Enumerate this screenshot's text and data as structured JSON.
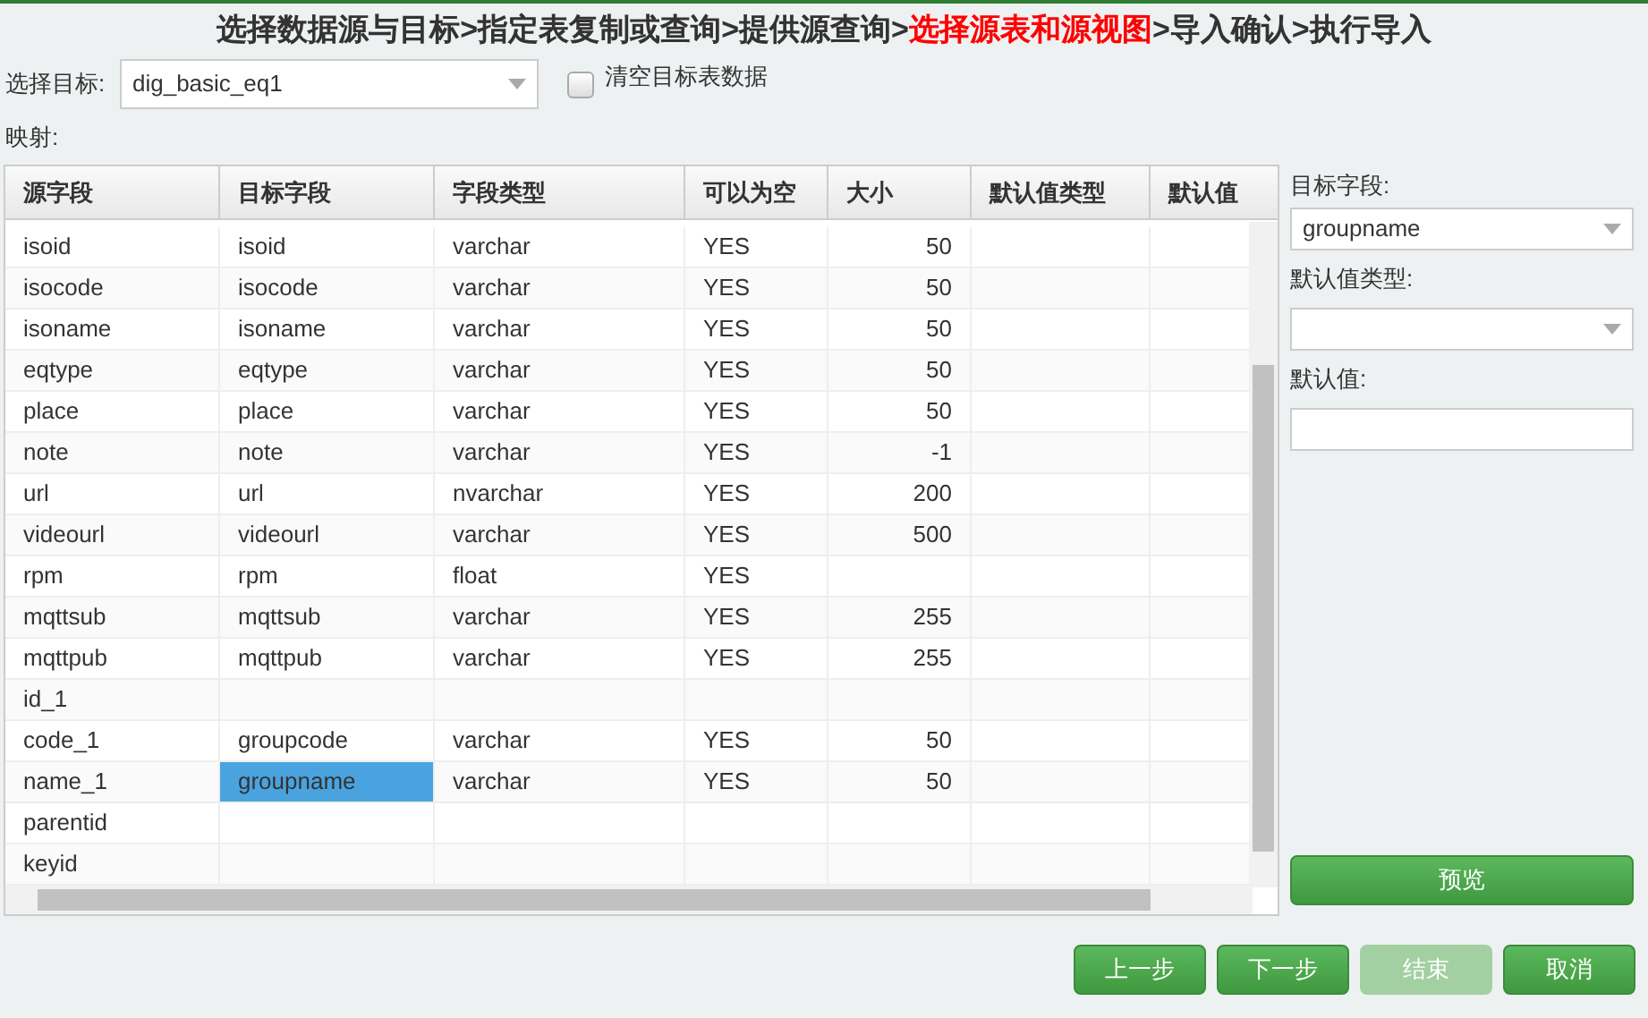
{
  "steps": [
    {
      "label": "选择数据源与目标",
      "current": false,
      "sep": ">"
    },
    {
      "label": "指定表复制或查询",
      "current": false,
      "sep": ">"
    },
    {
      "label": "提供源查询",
      "current": false,
      "sep": ">"
    },
    {
      "label": "选择源表和源视图",
      "current": true,
      "sep": ">"
    },
    {
      "label": "导入确认",
      "current": false,
      "sep": ">"
    },
    {
      "label": "执行导入",
      "current": false
    }
  ],
  "target": {
    "label": "选择目标:",
    "value": "dig_basic_eq1"
  },
  "clear_checkbox": {
    "label": "清空目标表数据",
    "checked": false
  },
  "mapping_label": "映射:",
  "table": {
    "columns": [
      "源字段",
      "目标字段",
      "字段类型",
      "可以为空",
      "大小",
      "默认值类型",
      "默认值"
    ],
    "rows": [
      {
        "cells": [
          "isoid",
          "isoid",
          "varchar",
          "YES",
          "50"
        ],
        "selected": false
      },
      {
        "cells": [
          "isocode",
          "isocode",
          "varchar",
          "YES",
          "50"
        ],
        "selected": false
      },
      {
        "cells": [
          "isoname",
          "isoname",
          "varchar",
          "YES",
          "50"
        ],
        "selected": false
      },
      {
        "cells": [
          "eqtype",
          "eqtype",
          "varchar",
          "YES",
          "50"
        ],
        "selected": false
      },
      {
        "cells": [
          "place",
          "place",
          "varchar",
          "YES",
          "50"
        ],
        "selected": false
      },
      {
        "cells": [
          "note",
          "note",
          "varchar",
          "YES",
          "-1"
        ],
        "selected": false
      },
      {
        "cells": [
          "url",
          "url",
          "nvarchar",
          "YES",
          "200"
        ],
        "selected": false
      },
      {
        "cells": [
          "videourl",
          "videourl",
          "varchar",
          "YES",
          "500"
        ],
        "selected": false
      },
      {
        "cells": [
          "rpm",
          "rpm",
          "float",
          "YES",
          ""
        ],
        "selected": false
      },
      {
        "cells": [
          "mqttsub",
          "mqttsub",
          "varchar",
          "YES",
          "255"
        ],
        "selected": false
      },
      {
        "cells": [
          "mqttpub",
          "mqttpub",
          "varchar",
          "YES",
          "255"
        ],
        "selected": false
      },
      {
        "cells": [
          "id_1",
          "",
          "",
          "",
          ""
        ],
        "selected": false
      },
      {
        "cells": [
          "code_1",
          "groupcode",
          "varchar",
          "YES",
          "50"
        ],
        "selected": false
      },
      {
        "cells": [
          "name_1",
          "groupname",
          "varchar",
          "YES",
          "50"
        ],
        "selected": true
      },
      {
        "cells": [
          "parentid",
          "",
          "",
          "",
          ""
        ],
        "selected": false
      },
      {
        "cells": [
          "keyid",
          "",
          "",
          "",
          ""
        ],
        "selected": false
      }
    ]
  },
  "side": {
    "target_label": "目标字段:",
    "target_value": "groupname",
    "default_type_label": "默认值类型:",
    "default_value_label": "默认值:",
    "preview": "预览"
  },
  "buttons": [
    {
      "label": "上一步",
      "disabled": false
    },
    {
      "label": "下一步",
      "disabled": false
    },
    {
      "label": "结束",
      "disabled": true
    },
    {
      "label": "取消",
      "disabled": false
    }
  ]
}
